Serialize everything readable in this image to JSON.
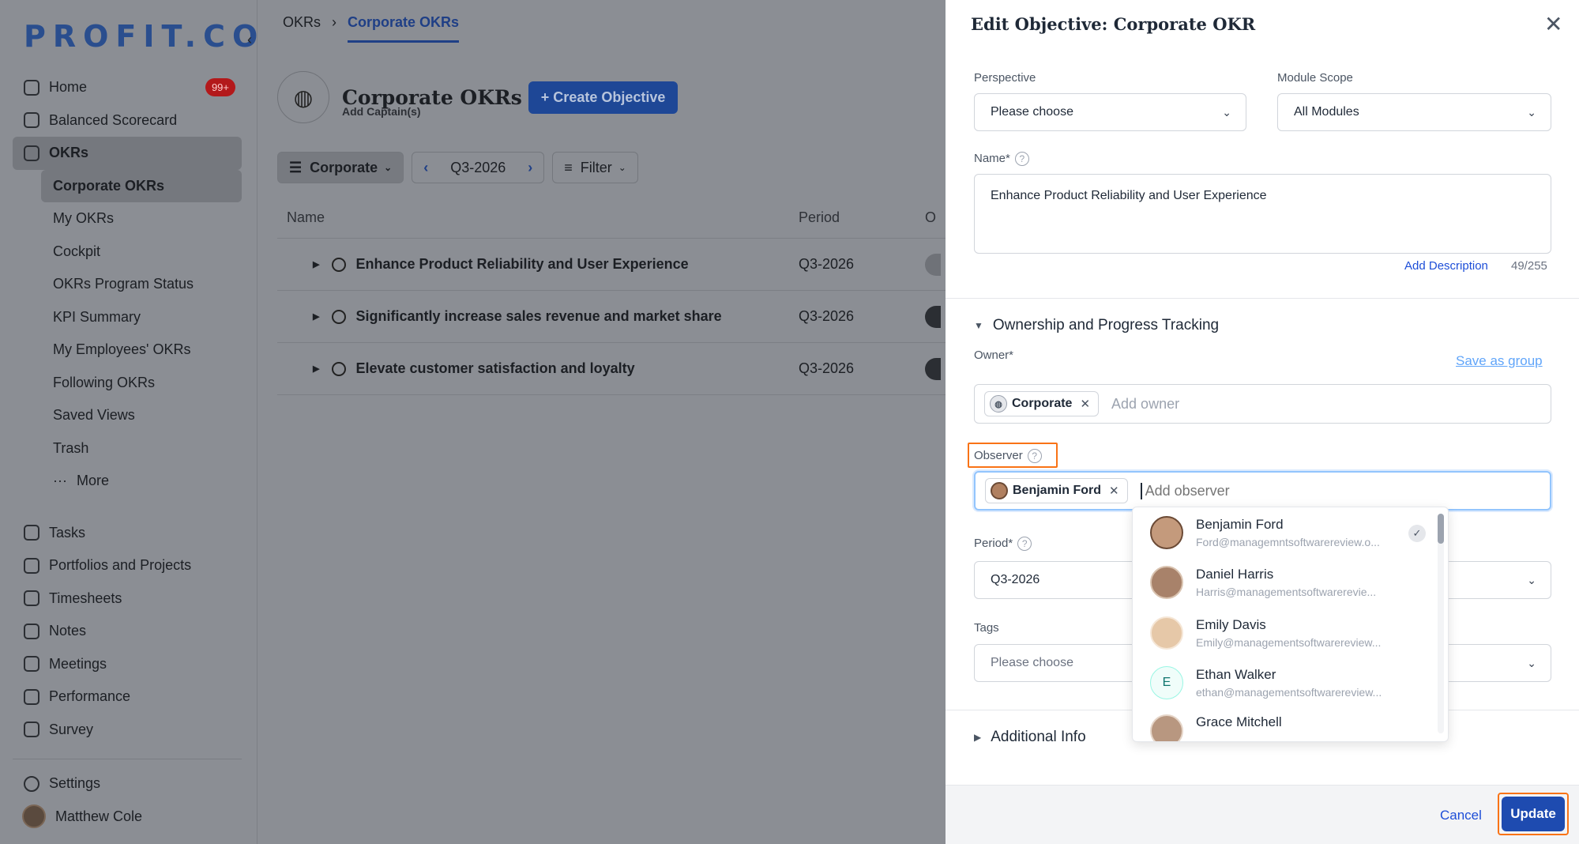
{
  "sidebar": {
    "logo": "PROFIT.CO",
    "collapse_icon": "‹",
    "home_label": "Home",
    "home_badge": "99+",
    "balanced_label": "Balanced Scorecard",
    "okrs_label": "OKRs",
    "okr_sub": [
      "Corporate OKRs",
      "My OKRs",
      "Cockpit",
      "OKRs Program Status",
      "KPI Summary",
      "My Employees' OKRs",
      "Following OKRs",
      "Saved Views",
      "Trash"
    ],
    "more_label": "More",
    "more_icon": "···",
    "items": [
      "Tasks",
      "Portfolios and Projects",
      "Timesheets",
      "Notes",
      "Meetings",
      "Performance",
      "Survey"
    ],
    "settings_label": "Settings",
    "user_name": "Matthew Cole"
  },
  "main": {
    "breadcrumb": [
      "OKRs",
      "Corporate OKRs"
    ],
    "breadcrumb_sep": "›",
    "page_title": "Corporate OKRs",
    "create_button": "+ Create Objective",
    "add_captains": "Add Captain(s)",
    "toolbar": {
      "view_label": "Corporate",
      "period": "Q3-2026",
      "filter_label": "Filter",
      "prev_icon": "‹",
      "next_icon": "›"
    },
    "table": {
      "columns": [
        "Name",
        "Period",
        "O"
      ],
      "rows": [
        {
          "name": "Enhance Product Reliability and User Experience",
          "period": "Q3-2026"
        },
        {
          "name": "Significantly increase sales revenue and market share",
          "period": "Q3-2026"
        },
        {
          "name": "Elevate customer satisfaction and loyalty",
          "period": "Q3-2026"
        }
      ]
    }
  },
  "modal": {
    "title": "Edit Objective: Corporate OKR",
    "close_icon": "✕",
    "perspective_label": "Perspective",
    "perspective_value": "Please choose",
    "module_scope_label": "Module Scope",
    "module_scope_value": "All Modules",
    "name_label": "Name*",
    "name_value": "Enhance Product Reliability and User Experience",
    "add_description": "Add Description",
    "char_count": "49/255",
    "ownership_section": "Ownership and Progress Tracking",
    "owner_label": "Owner*",
    "save_as_group": "Save as group",
    "owner_chip": "Corporate",
    "owner_placeholder": "Add owner",
    "observer_label": "Observer",
    "observer_chip": "Benjamin Ford",
    "observer_placeholder": "Add observer",
    "period_label": "Period*",
    "period_value": "Q3-2026",
    "tags_label": "Tags",
    "tags_value": "Please choose",
    "additional_info": "Additional Info",
    "cancel_label": "Cancel",
    "update_label": "Update",
    "help_icon": "?"
  },
  "observer_dropdown": {
    "items": [
      {
        "name": "Benjamin Ford",
        "email": "Ford@managemntsoftwarereview.o...",
        "selected": true
      },
      {
        "name": "Daniel Harris",
        "email": "Harris@managementsoftwarerevie..."
      },
      {
        "name": "Emily Davis",
        "email": "Emily@managementsoftwarereview..."
      },
      {
        "name": "Ethan Walker",
        "email": "ethan@managementsoftwarereview...",
        "initial": "E"
      },
      {
        "name": "Grace Mitchell",
        "email": ""
      }
    ]
  },
  "colors": {
    "accent": "#1e4bb0",
    "highlight": "#f97316",
    "overlay": "#8b8e94"
  }
}
